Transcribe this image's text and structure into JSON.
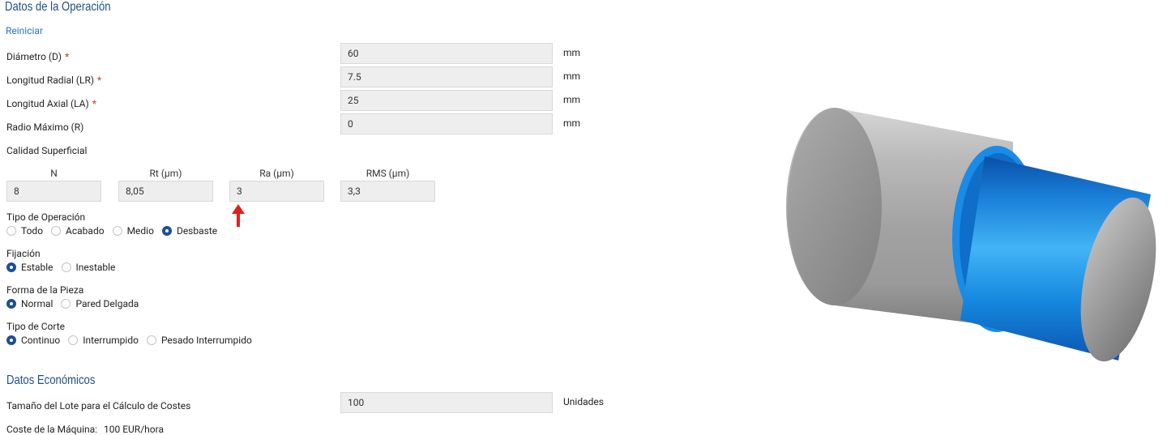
{
  "operation": {
    "title": "Datos de la Operación",
    "reset_label": "Reiniciar",
    "fields": [
      {
        "label": "Diámetro (D)",
        "required": "*",
        "value": "60",
        "unit": "mm"
      },
      {
        "label": "Longitud Radial (LR)",
        "required": "*",
        "value": "7.5",
        "unit": "mm"
      },
      {
        "label": "Longitud Axial (LA)",
        "required": "*",
        "value": "25",
        "unit": "mm"
      },
      {
        "label": "Radio Máximo (R)",
        "required": "",
        "value": "0",
        "unit": "mm"
      }
    ],
    "surface_quality": {
      "label": "Calidad Superficial",
      "columns": [
        {
          "header": "N",
          "value": "8"
        },
        {
          "header": "Rt (µm)",
          "value": "8,05"
        },
        {
          "header": "Ra (µm)",
          "value": "3"
        },
        {
          "header": "RMS (µm)",
          "value": "3,3"
        }
      ]
    },
    "radio_groups": [
      {
        "label": "Tipo de Operación",
        "options": [
          "Todo",
          "Acabado",
          "Medio",
          "Desbaste"
        ],
        "selected": 3
      },
      {
        "label": "Fijación",
        "options": [
          "Estable",
          "Inestable"
        ],
        "selected": 0
      },
      {
        "label": "Forma de la Pieza",
        "options": [
          "Normal",
          "Pared Delgada"
        ],
        "selected": 0
      },
      {
        "label": "Tipo de Corte",
        "options": [
          "Continuo",
          "Interrumpido",
          "Pesado Interrumpido"
        ],
        "selected": 0
      }
    ]
  },
  "economic": {
    "title": "Datos Económicos",
    "lot_label": "Tamaño del Lote para el Cálculo de Costes",
    "lot_value": "100",
    "lot_unit": "Unidades",
    "machine_cost_label": "Coste de la Máquina:",
    "machine_cost_value": "100 EUR/hora"
  },
  "colors": {
    "title": "#1f4e89",
    "link": "#2375c6",
    "required": "#d0302a",
    "radio_selected": "#1d4f91",
    "arrow": "#e0201b",
    "part_steel": "#a7a7a7",
    "part_machined": "#1e8fe0"
  },
  "icons": {
    "arrow": "red-up-arrow-icon",
    "illustration": "shoulder-turning-part-illustration"
  }
}
